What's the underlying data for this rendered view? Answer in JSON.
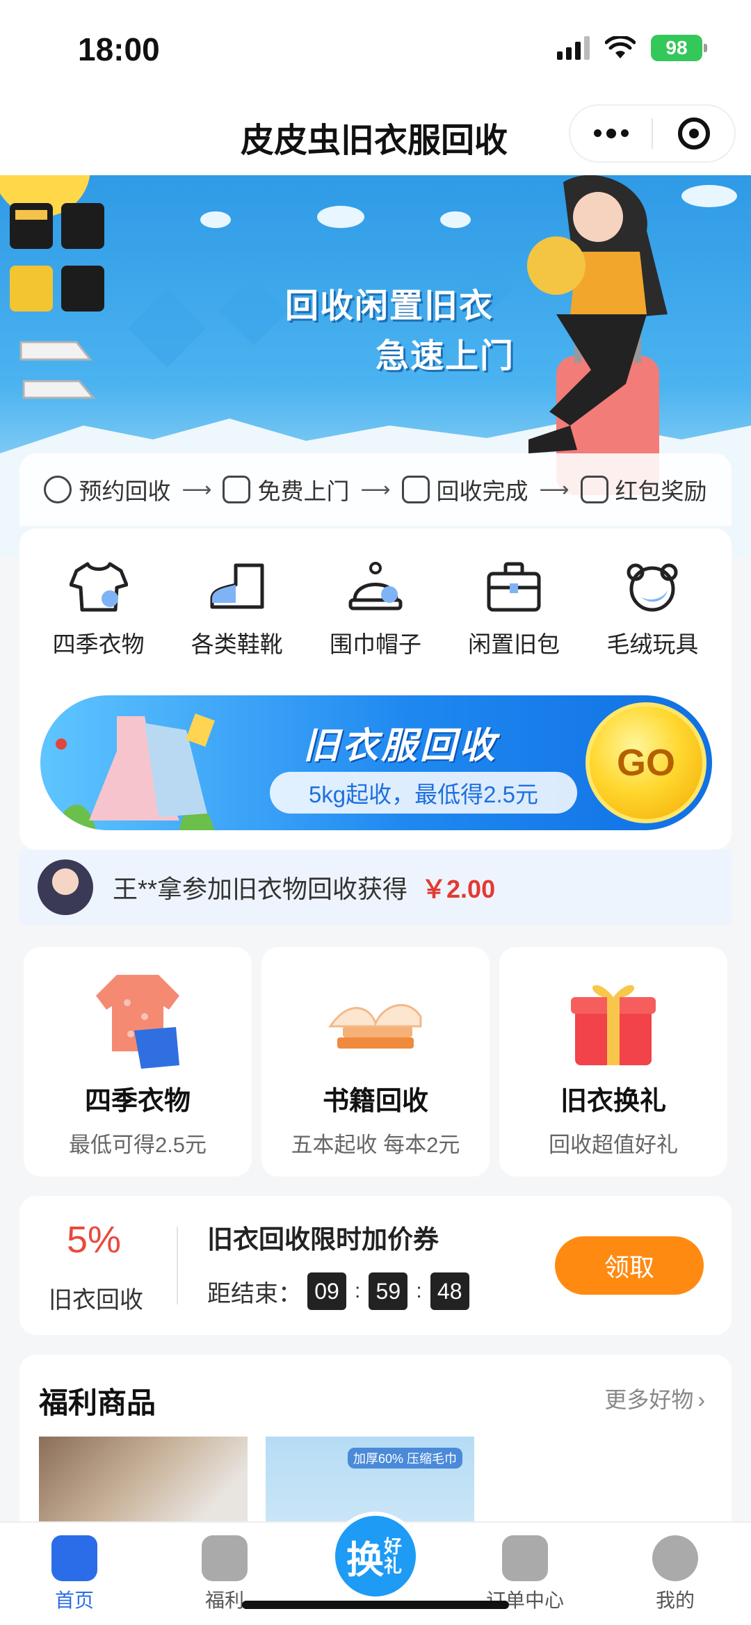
{
  "status": {
    "time": "18:00",
    "battery": "98"
  },
  "nav": {
    "title": "皮皮虫旧衣服回收"
  },
  "banner": {
    "headline_1": "回收闲置旧衣",
    "headline_2": "急速上门",
    "steps": [
      "预约回收",
      "免费上门",
      "回收完成",
      "红包奖励"
    ]
  },
  "categories": [
    "四季衣物",
    "各类鞋靴",
    "围巾帽子",
    "闲置旧包",
    "毛绒玩具"
  ],
  "promo": {
    "title": "旧衣服回收",
    "subtitle": "5kg起收，最低得2.5元",
    "go": "GO"
  },
  "ticker": {
    "text": "王**拿参加旧衣物回收获得",
    "amount": "￥2.00"
  },
  "features": [
    {
      "title": "四季衣物",
      "subtitle": "最低可得2.5元"
    },
    {
      "title": "书籍回收",
      "subtitle": "五本起收 每本2元"
    },
    {
      "title": "旧衣换礼",
      "subtitle": "回收超值好礼"
    }
  ],
  "coupon": {
    "percent": "5%",
    "percent_label": "旧衣回收",
    "title": "旧衣回收限时加价券",
    "ends_label": "距结束：",
    "hours": "09",
    "minutes": "59",
    "seconds": "48",
    "button": "领取"
  },
  "goods": {
    "title": "福利商品",
    "more": "更多好物",
    "item_2_tag": "加厚60% 压缩毛巾"
  },
  "tabbar": {
    "home": "首页",
    "fuli": "福利",
    "center_big": "换",
    "center_small": "好礼",
    "order": "订单中心",
    "mine": "我的"
  },
  "colors": {
    "accent": "#1d9bf5",
    "price_red": "#e23a32",
    "button_orange": "#ff8a12"
  }
}
